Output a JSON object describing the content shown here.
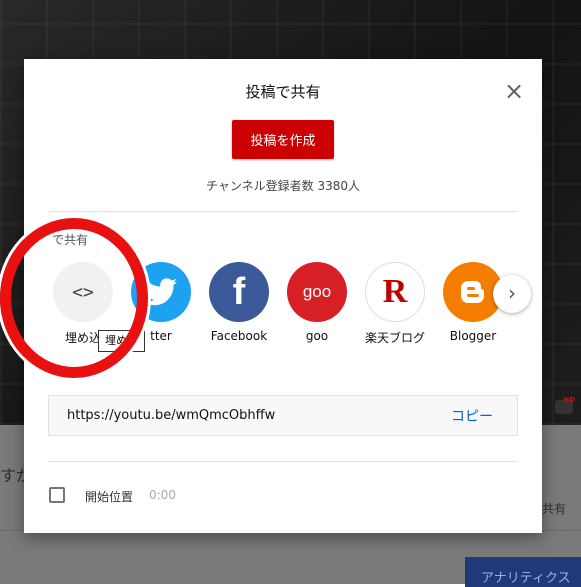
{
  "dialog": {
    "title": "投稿で共有",
    "close_icon": "×",
    "create_post_label": "投稿を作成",
    "subscriber_text": "チャンネル登録者数 3380人",
    "share_section_label": "で共有",
    "share_targets": [
      {
        "label": "埋め込"
      },
      {
        "label": "tter"
      },
      {
        "label": "Facebook"
      },
      {
        "label": "goo"
      },
      {
        "label": "楽天ブログ"
      },
      {
        "label": "Blogger"
      }
    ],
    "embed_icon_glyph": "<>",
    "facebook_glyph": "f",
    "goo_glyph": "goo",
    "rakuten_glyph": "R",
    "next_icon": "›",
    "url": "https://youtu.be/wmQmcObhffw",
    "copy_label": "コピー",
    "start_label": "開始位置",
    "start_time": "0:00"
  },
  "tooltip": "埋め込",
  "background": {
    "left_text": "すか",
    "right_text": "共有",
    "analytics_label": "アナリティクス"
  },
  "colors": {
    "create_button": "#cc0000",
    "copy_link": "#065fd4",
    "annotation_circle": "#e81010",
    "twitter": "#1da1f2",
    "facebook": "#3b5998",
    "goo": "#d71f26",
    "blogger": "#f57d00"
  }
}
